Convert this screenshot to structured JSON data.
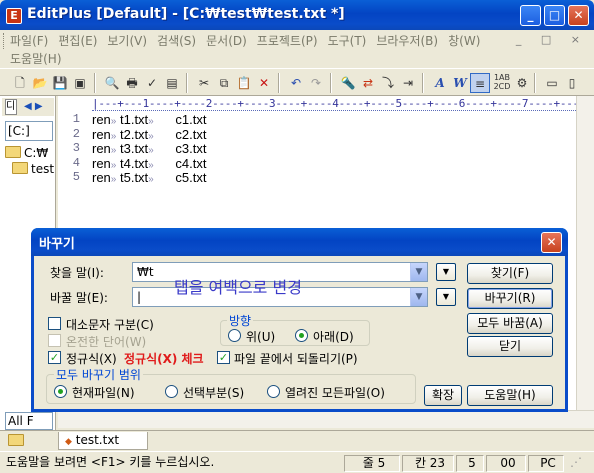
{
  "window": {
    "app_icon_letter": "E",
    "title": "EditPlus [Default] - [C:₩test₩test.txt *]",
    "minimize_glyph": "_",
    "maximize_glyph": "□",
    "close_glyph": "✕"
  },
  "menu": {
    "row1": [
      "파일(F)",
      "편집(E)",
      "보기(V)",
      "검색(S)",
      "문서(D)",
      "프로젝트(P)",
      "도구(T)",
      "브라우저(B)",
      "창(W)"
    ],
    "row2": [
      "도움말(H)"
    ],
    "mdi_buttons": "_ □ ×"
  },
  "sidebar": {
    "tab_label": "디",
    "arrows": "◀ ▶",
    "drive": "[C:]",
    "tree": [
      "C:₩",
      "test"
    ],
    "filter": "All F"
  },
  "editor": {
    "ruler": "|---+---1----+----2----+----3----+----4----+----5----+----6----+----7----+----8",
    "tab_mark": "»",
    "lines": [
      {
        "no": "1",
        "cmd": "ren",
        "src": "t1.txt",
        "dst": "c1.txt"
      },
      {
        "no": "2",
        "cmd": "ren",
        "src": "t2.txt",
        "dst": "c2.txt"
      },
      {
        "no": "3",
        "cmd": "ren",
        "src": "t3.txt",
        "dst": "c3.txt"
      },
      {
        "no": "4",
        "cmd": "ren",
        "src": "t4.txt",
        "dst": "c4.txt"
      },
      {
        "no": "5",
        "cmd": "ren",
        "src": "t5.txt",
        "dst": "c5.txt"
      }
    ]
  },
  "dialog": {
    "title": "바꾸기",
    "find_label": "찾을 말(I):",
    "find_value": "₩t",
    "replace_label": "바꿀 말(E):",
    "replace_value": "|",
    "annotation_blue": "탭을 여백으로 변경",
    "annotation_red": "정규식(X) 체크",
    "options": {
      "match_case": "대소문자 구분(C)",
      "whole_word": "온전한 단어(W)",
      "regex": "정규식(X)",
      "wrap": "파일 끝에서 되돌리기(P)"
    },
    "direction": {
      "label": "방향",
      "up": "위(U)",
      "down": "아래(D)"
    },
    "scope": {
      "label": "모두 바꾸기 범위",
      "current": "현재파일(N)",
      "selection": "선택부분(S)",
      "all_open": "열려진 모든파일(O)"
    },
    "buttons": {
      "find": "찾기(F)",
      "replace": "바꾸기(R)",
      "replace_all": "모두 바꿈(A)",
      "close": "닫기",
      "expand": "확장",
      "help": "도움말(H)"
    },
    "arrow_glyph": "▼"
  },
  "tabbar": {
    "doc": "test.txt"
  },
  "status": {
    "hint": "도움말을 보려면 <F1> 키를 누르십시오.",
    "line": "줄 5",
    "col": "칸 23",
    "num": "5",
    "val": "00",
    "mode": "PC"
  }
}
